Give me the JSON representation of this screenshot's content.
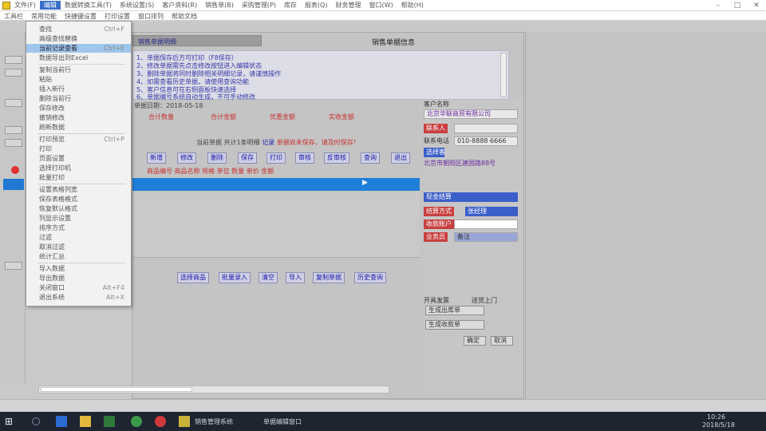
{
  "titlebar": {
    "menu": [
      "文件(F)",
      "编辑",
      "数据转换工具(T)",
      "系统设置(S)",
      "客户资料(R)",
      "销售单(B)",
      "采购管理(P)",
      "库存",
      "报表(Q)",
      "财务管理",
      "窗口(W)",
      "帮助(H)"
    ],
    "active_index": 1,
    "controls": {
      "minimize": "–",
      "maximize": "□",
      "close": "✕"
    }
  },
  "menubar2": {
    "items": [
      "工具栏",
      "常用功能",
      "快捷键设置",
      "打印设置",
      "窗口排列",
      "帮助文档"
    ]
  },
  "dropdown": {
    "items": [
      {
        "label": "查找",
        "shortcut": "Ctrl+F"
      },
      {
        "label": "高级查找替换",
        "shortcut": ""
      },
      {
        "label": "当前记录查看",
        "shortcut": "Ctrl+E",
        "highlight": true
      },
      {
        "label": "数据导出到Excel",
        "shortcut": ""
      },
      {
        "label": "复制当前行",
        "shortcut": ""
      },
      {
        "label": "粘贴",
        "shortcut": ""
      },
      {
        "label": "插入新行",
        "shortcut": ""
      },
      {
        "label": "删除当前行",
        "shortcut": ""
      },
      {
        "label": "保存修改",
        "shortcut": ""
      },
      {
        "label": "撤销修改",
        "shortcut": ""
      },
      {
        "label": "刷新数据",
        "shortcut": ""
      },
      {
        "label": "打印预览",
        "shortcut": "Ctrl+P"
      },
      {
        "label": "打印",
        "shortcut": ""
      },
      {
        "label": "页面设置",
        "shortcut": ""
      },
      {
        "label": "选择打印机",
        "shortcut": ""
      },
      {
        "label": "批量打印",
        "shortcut": ""
      },
      {
        "label": "设置表格列宽",
        "shortcut": ""
      },
      {
        "label": "保存表格格式",
        "shortcut": ""
      },
      {
        "label": "恢复默认格式",
        "shortcut": ""
      },
      {
        "label": "列显示设置",
        "shortcut": ""
      },
      {
        "label": "排序方式",
        "shortcut": ""
      },
      {
        "label": "过滤",
        "shortcut": ""
      },
      {
        "label": "取消过滤",
        "shortcut": ""
      },
      {
        "label": "统计汇总",
        "shortcut": ""
      },
      {
        "label": "导入数据",
        "shortcut": ""
      },
      {
        "label": "导出数据",
        "shortcut": ""
      },
      {
        "label": "关闭窗口",
        "shortcut": "Alt+F4"
      },
      {
        "label": "退出系统",
        "shortcut": "Alt+X"
      }
    ]
  },
  "main": {
    "header_label": "销售单据明细",
    "title": "销售单据信息",
    "notes": [
      "1、单据保存后方可打印（F8保存）",
      "2、修改单据需先点击修改按钮进入编辑状态",
      "3、删除单据将同时删除相关明细记录，请谨慎操作",
      "4、如需查看历史单据，请使用查询功能",
      "5、客户信息可在右侧面板快速选择",
      "6、单据编号系统自动生成，不可手动修改"
    ],
    "info_line": "单据日期：2018-05-18",
    "red_labels": [
      "合计数量",
      "合计金额",
      "优惠金额",
      "实收金额"
    ],
    "mid_line": {
      "prefix": "当前单据  共计1条明细",
      "blue": "记录",
      "red": "单据尚未保存，请及时保存！"
    },
    "buttons": [
      "新增",
      "修改",
      "删除",
      "保存",
      "打印",
      "审核",
      "反审核",
      "查询",
      "退出"
    ],
    "sub_row": "商品编号  商品名称  规格  单位  数量  单价  金额",
    "selected_marker": "▶",
    "bottom_buttons": [
      "选择商品",
      "批量录入",
      "清空",
      "导入",
      "复制单据",
      "历史查询"
    ]
  },
  "right_panel": {
    "customer_label": "客户名称",
    "customer_value": "北京华联商贸有限公司",
    "contact_label": "联系人",
    "contact_value": "",
    "phone_label": "联系电话",
    "phone_value": "010-8888 6666",
    "btn_select": "选择客户",
    "address_value": "北京市朝阳区建国路88号",
    "pay_label": "结算方式",
    "pay_value": "现金结算",
    "account_label": "收款账户",
    "account_value": "",
    "staff_label": "业务员",
    "staff_value": "张经理",
    "remark_label": "备注",
    "check_a": "开具发票",
    "check_b": "送货上门",
    "op_btn1": "生成出库单",
    "op_btn2": "生成收款单",
    "op_btn3": "确定",
    "op_btn4": "取消"
  },
  "taskbar": {
    "items": [
      "销售管理系统",
      "单据编辑窗口"
    ],
    "time": "10:26",
    "date": "2018/5/18"
  },
  "colors": {
    "selection_blue": "#1e7fd8",
    "alert_red": "#c83030",
    "link_blue": "#2020b0"
  }
}
